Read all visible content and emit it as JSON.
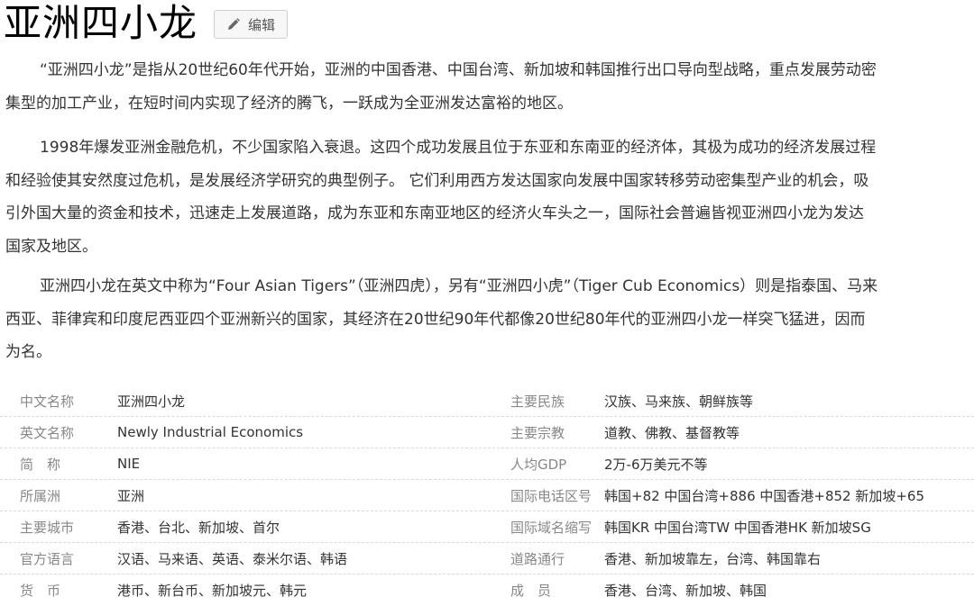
{
  "header": {
    "title": "亚洲四小龙",
    "edit_label": "编辑",
    "edit_icon": "pencil-icon"
  },
  "paragraphs": [
    {
      "lines": [
        "“亚洲四小龙”是指从20世纪60年代开始，亚洲的中国香港、中国台湾、新加坡和韩国推行出口导向型战略，重点发展劳动密",
        "集型的加工产业，在短时间内实现了经济的腾飞，一跃成为全亚洲发达富裕的地区。"
      ]
    },
    {
      "lines": [
        "1998年爆发亚洲金融危机，不少国家陷入衰退。这四个成功发展且位于东亚和东南亚的经济体，其极为成功的经济发展过程",
        "和经验使其安然度过危机，是发展经济学研究的典型例子。 它们利用西方发达国家向发展中国家转移劳动密集型产业的机会，吸",
        "引外国大量的资金和技术，迅速走上发展道路，成为东亚和东南亚地区的经济火车头之一，国际社会普遍皆视亚洲四小龙为发达",
        "国家及地区。"
      ]
    },
    {
      "lines": [
        "亚洲四小龙在英文中称为“Four Asian Tigers”（亚洲四虎），另有“亚洲四小虎”（Tiger Cub Economics）则是指泰国、马来",
        "西亚、菲律宾和印度尼西亚四个亚洲新兴的国家，其经济在20世纪90年代都像20世纪80年代的亚洲四小龙一样突飞猛进，因而",
        "为名。"
      ]
    }
  ],
  "infobox": [
    {
      "k1": "中文名称",
      "v1": "亚洲四小龙",
      "k2": "主要民族",
      "v2": "汉族、马来族、朝鲜族等"
    },
    {
      "k1": "英文名称",
      "v1": "Newly Industrial Economics",
      "k2": "主要宗教",
      "v2": "道教、佛教、基督教等"
    },
    {
      "k1": "简　称",
      "v1": "NIE",
      "k2": "人均GDP",
      "v2": "2万-6万美元不等"
    },
    {
      "k1": "所属洲",
      "v1": "亚洲",
      "k2": "国际电话区号",
      "v2": "韩国+82 中国台湾+886 中国香港+852 新加坡+65"
    },
    {
      "k1": "主要城市",
      "v1": "香港、台北、新加坡、首尔",
      "k2": "国际域名缩写",
      "v2": "韩国KR 中国台湾TW 中国香港HK 新加坡SG"
    },
    {
      "k1": "官方语言",
      "v1": "汉语、马来语、英语、泰米尔语、韩语",
      "k2": "道路通行",
      "v2": "香港、新加坡靠左，台湾、韩国靠右"
    },
    {
      "k1": "货　币",
      "v1": "港币、新台币、新加坡元、韩元",
      "k2": "成　员",
      "v2": "香港、台湾、新加坡、韩国"
    }
  ]
}
